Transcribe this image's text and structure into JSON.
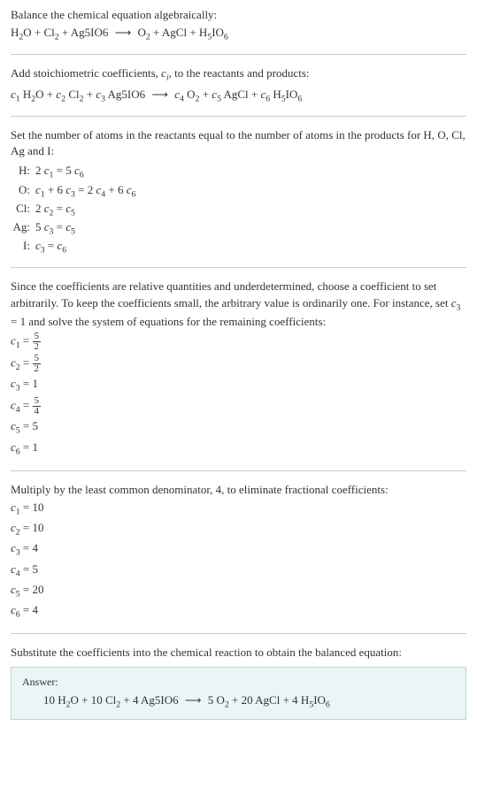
{
  "section1": {
    "title": "Balance the chemical equation algebraically:",
    "reactant1": "H",
    "reactant1_sub1": "2",
    "reactant1_rest": "O + Cl",
    "reactant1_sub2": "2",
    "reactant1_rest2": " + Ag5IO6",
    "arrow": "⟶",
    "product1": "O",
    "product1_sub": "2",
    "product1_rest": " + AgCl + H",
    "product1_sub2": "5",
    "product1_rest2": "IO",
    "product1_sub3": "6"
  },
  "section2": {
    "title_a": "Add stoichiometric coefficients, ",
    "title_ci": "c",
    "title_ci_sub": "i",
    "title_b": ", to the reactants and products:",
    "c1": "c",
    "c1_sub": "1",
    "r1": " H",
    "r1_sub": "2",
    "r1_rest": "O + ",
    "c2": "c",
    "c2_sub": "2",
    "r2": " Cl",
    "r2_sub": "2",
    "r2_rest": " + ",
    "c3": "c",
    "c3_sub": "3",
    "r3": " Ag5IO6 ",
    "arrow": "⟶",
    "c4": " c",
    "c4_sub": "4",
    "p1": " O",
    "p1_sub": "2",
    "p1_rest": " + ",
    "c5": "c",
    "c5_sub": "5",
    "p2": " AgCl + ",
    "c6": "c",
    "c6_sub": "6",
    "p3": " H",
    "p3_sub": "5",
    "p3_rest": "IO",
    "p3_sub2": "6"
  },
  "section3": {
    "title": "Set the number of atoms in the reactants equal to the number of atoms in the products for H, O, Cl, Ag and I:",
    "rows": [
      {
        "label": "H:",
        "lhs_a": "2 ",
        "lhs_c": "c",
        "lhs_sub": "1",
        "eq": " = 5 ",
        "rhs_c": "c",
        "rhs_sub": "6"
      },
      {
        "label": "O:",
        "lhs_c": "c",
        "lhs_sub": "1",
        "mid": " + 6 ",
        "mid_c": "c",
        "mid_sub": "3",
        "eq": " = 2 ",
        "rhs_c": "c",
        "rhs_sub": "4",
        "rhs2": " + 6 ",
        "rhs2_c": "c",
        "rhs2_sub": "6"
      },
      {
        "label": "Cl:",
        "lhs_a": "2 ",
        "lhs_c": "c",
        "lhs_sub": "2",
        "eq": " = ",
        "rhs_c": "c",
        "rhs_sub": "5"
      },
      {
        "label": "Ag:",
        "lhs_a": "5 ",
        "lhs_c": "c",
        "lhs_sub": "3",
        "eq": " = ",
        "rhs_c": "c",
        "rhs_sub": "5"
      },
      {
        "label": "I:",
        "lhs_c": "c",
        "lhs_sub": "3",
        "eq": " = ",
        "rhs_c": "c",
        "rhs_sub": "6"
      }
    ]
  },
  "section4": {
    "title_a": "Since the coefficients are relative quantities and underdetermined, choose a coefficient to set arbitrarily. To keep the coefficients small, the arbitrary value is ordinarily one. For instance, set ",
    "title_c": "c",
    "title_sub": "3",
    "title_b": " = 1 and solve the system of equations for the remaining coefficients:",
    "c1_c": "c",
    "c1_sub": "1",
    "c1_eq": " = ",
    "c1_num": "5",
    "c1_den": "2",
    "c2_c": "c",
    "c2_sub": "2",
    "c2_eq": " = ",
    "c2_num": "5",
    "c2_den": "2",
    "c3_c": "c",
    "c3_sub": "3",
    "c3_val": " = 1",
    "c4_c": "c",
    "c4_sub": "4",
    "c4_eq": " = ",
    "c4_num": "5",
    "c4_den": "4",
    "c5_c": "c",
    "c5_sub": "5",
    "c5_val": " = 5",
    "c6_c": "c",
    "c6_sub": "6",
    "c6_val": " = 1"
  },
  "section5": {
    "title": "Multiply by the least common denominator, 4, to eliminate fractional coefficients:",
    "c1_c": "c",
    "c1_sub": "1",
    "c1_val": " = 10",
    "c2_c": "c",
    "c2_sub": "2",
    "c2_val": " = 10",
    "c3_c": "c",
    "c3_sub": "3",
    "c3_val": " = 4",
    "c4_c": "c",
    "c4_sub": "4",
    "c4_val": " = 5",
    "c5_c": "c",
    "c5_sub": "5",
    "c5_val": " = 20",
    "c6_c": "c",
    "c6_sub": "6",
    "c6_val": " = 4"
  },
  "section6": {
    "title": "Substitute the coefficients into the chemical reaction to obtain the balanced equation:",
    "answer_label": "Answer:",
    "eq_a": "10 H",
    "eq_sub1": "2",
    "eq_b": "O + 10 Cl",
    "eq_sub2": "2",
    "eq_c": " + 4 Ag5IO6 ",
    "arrow": "⟶",
    "eq_d": " 5 O",
    "eq_sub3": "2",
    "eq_e": " + 20 AgCl + 4 H",
    "eq_sub4": "5",
    "eq_f": "IO",
    "eq_sub5": "6"
  }
}
